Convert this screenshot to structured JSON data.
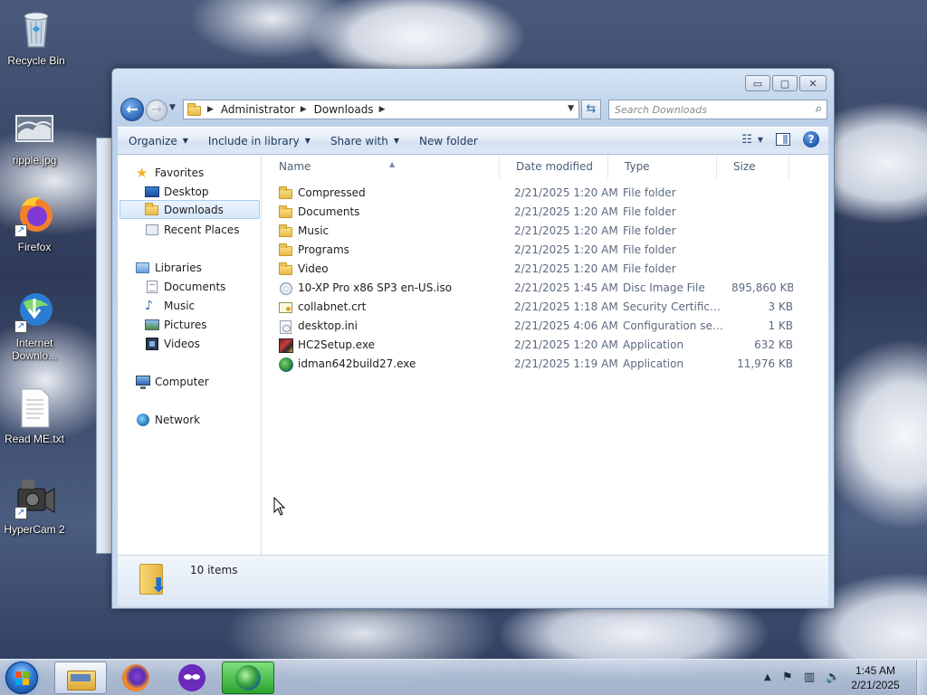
{
  "desktop": {
    "icons": [
      {
        "label": "Recycle Bin",
        "icon": "recycle-bin-icon"
      },
      {
        "label": "ripple.jpg",
        "icon": "image-file-icon"
      },
      {
        "label": "Firefox",
        "icon": "firefox-icon"
      },
      {
        "label": "Internet Downlo...",
        "icon": "internet-download-manager-icon"
      },
      {
        "label": "Read ME.txt",
        "icon": "text-file-icon"
      },
      {
        "label": "HyperCam 2",
        "icon": "hypercam-icon"
      }
    ]
  },
  "window": {
    "controls": {
      "minimize": "▭",
      "maximize": "▢",
      "close": "✕"
    },
    "address": {
      "crumbs": [
        "Administrator",
        "Downloads"
      ]
    },
    "search": {
      "placeholder": "Search Downloads"
    },
    "commands": {
      "organize": "Organize",
      "include_in_library": "Include in library",
      "share_with": "Share with",
      "new_folder": "New folder"
    },
    "nav": {
      "favorites": "Favorites",
      "desktop": "Desktop",
      "downloads": "Downloads",
      "recent_places": "Recent Places",
      "libraries": "Libraries",
      "documents": "Documents",
      "music": "Music",
      "pictures": "Pictures",
      "videos": "Videos",
      "computer": "Computer",
      "network": "Network"
    },
    "columns": {
      "name": "Name",
      "date_modified": "Date modified",
      "type": "Type",
      "size": "Size"
    },
    "files": [
      {
        "name": "Compressed",
        "date": "2/21/2025 1:20 AM",
        "type": "File folder",
        "size": "",
        "icon": "folder-icon"
      },
      {
        "name": "Documents",
        "date": "2/21/2025 1:20 AM",
        "type": "File folder",
        "size": "",
        "icon": "folder-icon"
      },
      {
        "name": "Music",
        "date": "2/21/2025 1:20 AM",
        "type": "File folder",
        "size": "",
        "icon": "folder-icon"
      },
      {
        "name": "Programs",
        "date": "2/21/2025 1:20 AM",
        "type": "File folder",
        "size": "",
        "icon": "folder-icon"
      },
      {
        "name": "Video",
        "date": "2/21/2025 1:20 AM",
        "type": "File folder",
        "size": "",
        "icon": "folder-icon"
      },
      {
        "name": "10-XP Pro x86 SP3 en-US.iso",
        "date": "2/21/2025 1:45 AM",
        "type": "Disc Image File",
        "size": "895,860 KB",
        "icon": "disc-image-icon"
      },
      {
        "name": "collabnet.crt",
        "date": "2/21/2025 1:18 AM",
        "type": "Security Certificate",
        "size": "3 KB",
        "icon": "certificate-icon"
      },
      {
        "name": "desktop.ini",
        "date": "2/21/2025 4:06 AM",
        "type": "Configuration sett...",
        "size": "1 KB",
        "icon": "config-file-icon"
      },
      {
        "name": "HC2Setup.exe",
        "date": "2/21/2025 1:20 AM",
        "type": "Application",
        "size": "632 KB",
        "icon": "hypercam-setup-icon"
      },
      {
        "name": "idman642build27.exe",
        "date": "2/21/2025 1:19 AM",
        "type": "Application",
        "size": "11,976 KB",
        "icon": "idm-installer-icon"
      }
    ],
    "status": {
      "item_count": "10 items"
    }
  },
  "taskbar": {
    "pinned": [
      "windows-explorer-icon",
      "firefox-icon",
      "privacy-mask-icon",
      "internet-download-manager-icon"
    ],
    "clock": {
      "time": "1:45 AM",
      "date": "2/21/2025"
    }
  }
}
